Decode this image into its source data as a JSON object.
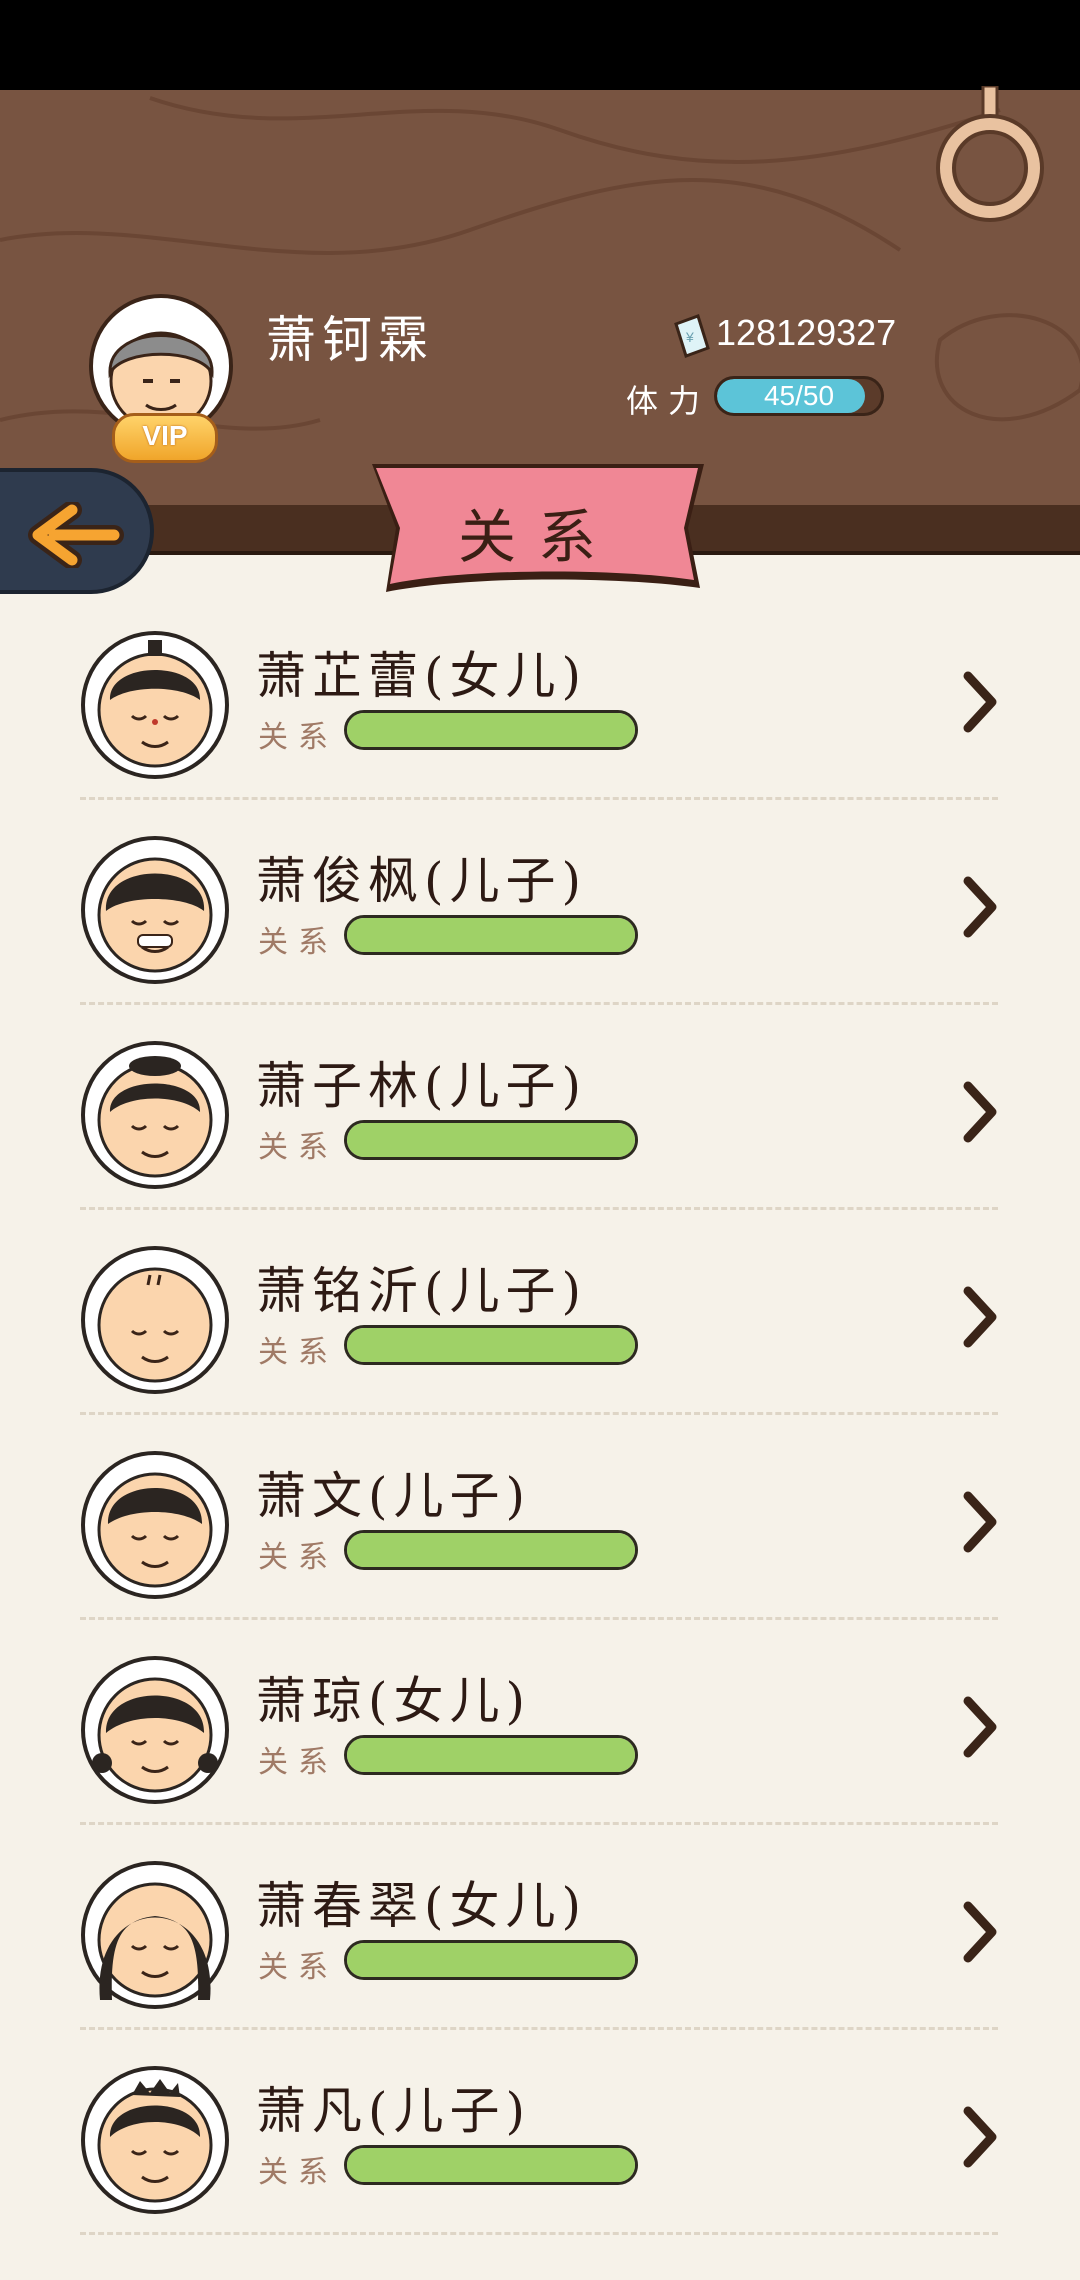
{
  "header": {
    "player_name": "萧钶霖",
    "vip_badge": "VIP",
    "money": "128129327",
    "stamina_label": "体力",
    "stamina_text": "45/50",
    "stamina_fraction": 0.9,
    "banner_title": "关系"
  },
  "colors": {
    "header_wood": "#785441",
    "banner": "#f08795",
    "relation_bar": "#9fd167",
    "stamina_bar": "#5cc4d8",
    "page_bg": "#f6f2e9"
  },
  "relation_label": "关系",
  "relations": [
    {
      "name": "萧芷蕾(女儿)",
      "relation_level": 1.0,
      "avatar": "girl-bun-icon"
    },
    {
      "name": "萧俊枫(儿子)",
      "relation_level": 1.0,
      "avatar": "boy-grin-icon"
    },
    {
      "name": "萧子林(儿子)",
      "relation_level": 1.0,
      "avatar": "boy-topknot-icon"
    },
    {
      "name": "萧铭沂(儿子)",
      "relation_level": 1.0,
      "avatar": "bald-man-icon"
    },
    {
      "name": "萧文(儿子)",
      "relation_level": 1.0,
      "avatar": "boy-short-hair-icon"
    },
    {
      "name": "萧琼(女儿)",
      "relation_level": 1.0,
      "avatar": "girl-pigtails-icon"
    },
    {
      "name": "萧春翠(女儿)",
      "relation_level": 1.0,
      "avatar": "girl-long-hair-icon"
    },
    {
      "name": "萧凡(儿子)",
      "relation_level": 1.0,
      "avatar": "boy-spiky-hair-icon"
    }
  ]
}
